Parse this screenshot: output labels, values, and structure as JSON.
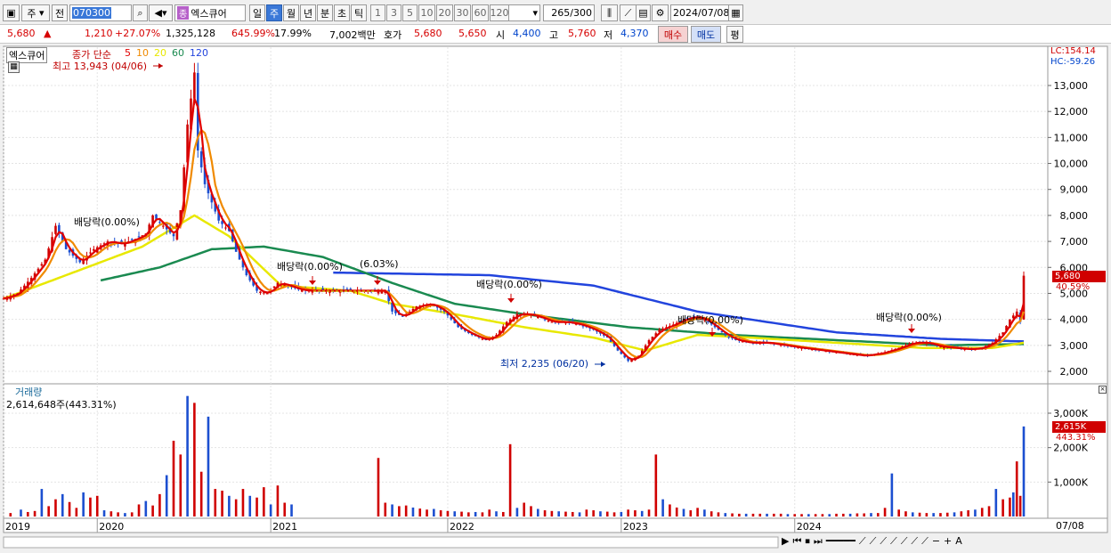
{
  "toolbar": {
    "market_sel": "주",
    "prev_label": "전",
    "stock_code": "070300",
    "stock_badge": "종",
    "stock_name": "엑스큐어",
    "periods": [
      "일",
      "주",
      "월",
      "년",
      "분",
      "초",
      "틱"
    ],
    "active_period": "주",
    "intervals": [
      "1",
      "3",
      "5",
      "10",
      "20",
      "30",
      "60",
      "120"
    ],
    "count": "265",
    "count_total": "/300",
    "date": "2024/07/08"
  },
  "quote": {
    "price": "5,680",
    "change_arrow": "▲",
    "change": "1,210",
    "change_pct": "+27.07%",
    "volume": "1,325,128",
    "volume_ratio": "645.99%",
    "turnover": "17.99%",
    "amount": "7,002백만",
    "hoga_label": "호가",
    "ask": "5,680",
    "bid": "5,650",
    "open_label": "시",
    "open": "4,400",
    "high_label": "고",
    "high": "5,760",
    "low_label": "저",
    "low": "4,370",
    "buy_button": "매수",
    "sell_button": "매도",
    "eval_button": "평"
  },
  "price_panel": {
    "stock_tag": "엑스큐어",
    "legend_prefix": "종가 단순",
    "ma_periods": [
      "5",
      "10",
      "20",
      "60",
      "120"
    ],
    "ma_colors": [
      "#e00000",
      "#f08a00",
      "#e8e800",
      "#1a8a50",
      "#2244dd"
    ],
    "lc": "LC:154.14",
    "hc": "HC:-59.26",
    "high_note": "최고 13,943 (04/06)",
    "low_note": "최저 2,235 (06/20)",
    "dividend_notes": [
      "배당락(0.00%)",
      "배당락(0.00%)",
      "(6.03%)",
      "배당락(0.00%)",
      "배당락(0.00%)",
      "배당락(0.00%)"
    ],
    "last_price_tag": "5,680",
    "last_pct_tag": "40.59%"
  },
  "volume_panel": {
    "title": "거래량",
    "value_line": "2,614,648주(443.31%)",
    "last_vol_tag": "2,615K",
    "last_vol_pct": "443.31%"
  },
  "x_axis": {
    "labels": [
      "2019",
      "2020",
      "2021",
      "2022",
      "2023",
      "2024"
    ],
    "right_date": "07/08"
  },
  "chart_data": {
    "type": "candlestick",
    "price_axis": {
      "ticks": [
        "2,000",
        "3,000",
        "4,000",
        "5,000",
        "6,000",
        "7,000",
        "8,000",
        "9,000",
        "10,000",
        "11,000",
        "12,000",
        "13,000"
      ],
      "ylim": [
        1500,
        14500
      ]
    },
    "volume_axis": {
      "ticks": [
        "1,000K",
        "2,000K",
        "3,000K"
      ],
      "ylim": [
        0,
        3500000
      ]
    },
    "anchors": [
      [
        0,
        4800
      ],
      [
        4,
        5000
      ],
      [
        8,
        5600
      ],
      [
        12,
        6300
      ],
      [
        15,
        7600
      ],
      [
        18,
        6700
      ],
      [
        22,
        6200
      ],
      [
        26,
        6700
      ],
      [
        30,
        7000
      ],
      [
        34,
        6900
      ],
      [
        38,
        7100
      ],
      [
        41,
        7300
      ],
      [
        43,
        8000
      ],
      [
        46,
        7600
      ],
      [
        49,
        7200
      ],
      [
        51,
        8200
      ],
      [
        53,
        11500
      ],
      [
        55,
        13500
      ],
      [
        56,
        10500
      ],
      [
        58,
        9200
      ],
      [
        60,
        8500
      ],
      [
        62,
        7800
      ],
      [
        65,
        7400
      ],
      [
        67,
        6600
      ],
      [
        70,
        5700
      ],
      [
        73,
        5100
      ],
      [
        76,
        5000
      ],
      [
        79,
        5400
      ],
      [
        82,
        5300
      ],
      [
        85,
        5150
      ],
      [
        88,
        5100
      ],
      [
        92,
        5100
      ],
      [
        100,
        5100
      ],
      [
        110,
        5100
      ],
      [
        112,
        4300
      ],
      [
        115,
        4100
      ],
      [
        119,
        4500
      ],
      [
        123,
        4600
      ],
      [
        127,
        4300
      ],
      [
        131,
        3700
      ],
      [
        135,
        3400
      ],
      [
        139,
        3200
      ],
      [
        142,
        3400
      ],
      [
        145,
        3900
      ],
      [
        148,
        4200
      ],
      [
        151,
        4200
      ],
      [
        154,
        4100
      ],
      [
        158,
        3900
      ],
      [
        162,
        3900
      ],
      [
        166,
        3800
      ],
      [
        170,
        3600
      ],
      [
        174,
        3300
      ],
      [
        177,
        2800
      ],
      [
        180,
        2400
      ],
      [
        183,
        2600
      ],
      [
        186,
        3200
      ],
      [
        189,
        3600
      ],
      [
        193,
        3800
      ],
      [
        196,
        4000
      ],
      [
        199,
        4100
      ],
      [
        202,
        4000
      ],
      [
        205,
        3700
      ],
      [
        208,
        3400
      ],
      [
        211,
        3200
      ],
      [
        215,
        3100
      ],
      [
        220,
        3100
      ],
      [
        225,
        3000
      ],
      [
        230,
        2900
      ],
      [
        236,
        2800
      ],
      [
        242,
        2700
      ],
      [
        248,
        2600
      ],
      [
        253,
        2700
      ],
      [
        258,
        2900
      ],
      [
        262,
        3100
      ],
      [
        266,
        3100
      ],
      [
        270,
        2950
      ],
      [
        274,
        2900
      ],
      [
        278,
        2850
      ],
      [
        282,
        2900
      ],
      [
        285,
        3100
      ],
      [
        288,
        3500
      ],
      [
        290,
        4000
      ],
      [
        292,
        4300
      ],
      [
        293,
        3900
      ],
      [
        294,
        5680
      ]
    ],
    "ma120_anchors": [
      [
        95,
        5800
      ],
      [
        140,
        5700
      ],
      [
        170,
        5300
      ],
      [
        200,
        4300
      ],
      [
        240,
        3500
      ],
      [
        270,
        3250
      ],
      [
        294,
        3150
      ]
    ],
    "ma60_anchors": [
      [
        28,
        5500
      ],
      [
        45,
        6000
      ],
      [
        60,
        6700
      ],
      [
        75,
        6800
      ],
      [
        92,
        6400
      ],
      [
        112,
        5400
      ],
      [
        130,
        4600
      ],
      [
        150,
        4200
      ],
      [
        180,
        3700
      ],
      [
        210,
        3400
      ],
      [
        240,
        3200
      ],
      [
        270,
        3000
      ],
      [
        294,
        3050
      ]
    ],
    "ma20_anchors": [
      [
        0,
        4800
      ],
      [
        20,
        5800
      ],
      [
        40,
        6800
      ],
      [
        55,
        8000
      ],
      [
        65,
        7200
      ],
      [
        80,
        5300
      ],
      [
        100,
        5100
      ],
      [
        112,
        4600
      ],
      [
        130,
        4200
      ],
      [
        150,
        3700
      ],
      [
        170,
        3300
      ],
      [
        185,
        2800
      ],
      [
        200,
        3400
      ],
      [
        215,
        3300
      ],
      [
        240,
        3100
      ],
      [
        265,
        2900
      ],
      [
        285,
        2900
      ],
      [
        294,
        3100
      ]
    ],
    "volumes": [
      [
        2,
        100000
      ],
      [
        5,
        200000
      ],
      [
        7,
        130000
      ],
      [
        9,
        160000
      ],
      [
        11,
        800000
      ],
      [
        13,
        300000
      ],
      [
        15,
        500000
      ],
      [
        17,
        650000
      ],
      [
        19,
        420000
      ],
      [
        21,
        250000
      ],
      [
        23,
        700000
      ],
      [
        25,
        550000
      ],
      [
        27,
        600000
      ],
      [
        29,
        180000
      ],
      [
        31,
        150000
      ],
      [
        33,
        120000
      ],
      [
        35,
        100000
      ],
      [
        37,
        120000
      ],
      [
        39,
        350000
      ],
      [
        41,
        450000
      ],
      [
        43,
        320000
      ],
      [
        45,
        650000
      ],
      [
        47,
        1200000
      ],
      [
        49,
        2200000
      ],
      [
        51,
        1800000
      ],
      [
        53,
        3500000
      ],
      [
        55,
        3300000
      ],
      [
        57,
        1300000
      ],
      [
        59,
        2900000
      ],
      [
        61,
        800000
      ],
      [
        63,
        750000
      ],
      [
        65,
        600000
      ],
      [
        67,
        500000
      ],
      [
        69,
        800000
      ],
      [
        71,
        600000
      ],
      [
        73,
        550000
      ],
      [
        75,
        850000
      ],
      [
        77,
        350000
      ],
      [
        79,
        900000
      ],
      [
        81,
        400000
      ],
      [
        83,
        350000
      ],
      [
        108,
        1700000
      ],
      [
        110,
        400000
      ],
      [
        112,
        350000
      ],
      [
        114,
        300000
      ],
      [
        116,
        320000
      ],
      [
        118,
        260000
      ],
      [
        120,
        230000
      ],
      [
        122,
        200000
      ],
      [
        124,
        220000
      ],
      [
        126,
        180000
      ],
      [
        128,
        160000
      ],
      [
        130,
        150000
      ],
      [
        132,
        140000
      ],
      [
        134,
        120000
      ],
      [
        136,
        130000
      ],
      [
        138,
        120000
      ],
      [
        140,
        200000
      ],
      [
        142,
        150000
      ],
      [
        144,
        130000
      ],
      [
        146,
        2100000
      ],
      [
        148,
        250000
      ],
      [
        150,
        400000
      ],
      [
        152,
        300000
      ],
      [
        154,
        220000
      ],
      [
        156,
        180000
      ],
      [
        158,
        160000
      ],
      [
        160,
        150000
      ],
      [
        162,
        140000
      ],
      [
        164,
        130000
      ],
      [
        166,
        120000
      ],
      [
        168,
        200000
      ],
      [
        170,
        180000
      ],
      [
        172,
        150000
      ],
      [
        174,
        140000
      ],
      [
        176,
        120000
      ],
      [
        178,
        130000
      ],
      [
        180,
        200000
      ],
      [
        182,
        180000
      ],
      [
        184,
        160000
      ],
      [
        186,
        200000
      ],
      [
        188,
        1800000
      ],
      [
        190,
        500000
      ],
      [
        192,
        350000
      ],
      [
        194,
        260000
      ],
      [
        196,
        220000
      ],
      [
        198,
        180000
      ],
      [
        200,
        250000
      ],
      [
        202,
        200000
      ],
      [
        204,
        150000
      ],
      [
        206,
        120000
      ],
      [
        208,
        100000
      ],
      [
        210,
        90000
      ],
      [
        212,
        80000
      ],
      [
        214,
        80000
      ],
      [
        216,
        80000
      ],
      [
        218,
        80000
      ],
      [
        220,
        80000
      ],
      [
        222,
        80000
      ],
      [
        224,
        80000
      ],
      [
        226,
        70000
      ],
      [
        228,
        70000
      ],
      [
        230,
        70000
      ],
      [
        232,
        70000
      ],
      [
        234,
        70000
      ],
      [
        236,
        70000
      ],
      [
        238,
        70000
      ],
      [
        240,
        80000
      ],
      [
        242,
        80000
      ],
      [
        244,
        80000
      ],
      [
        246,
        90000
      ],
      [
        248,
        90000
      ],
      [
        250,
        100000
      ],
      [
        252,
        100000
      ],
      [
        254,
        250000
      ],
      [
        256,
        1250000
      ],
      [
        258,
        200000
      ],
      [
        260,
        150000
      ],
      [
        262,
        120000
      ],
      [
        264,
        110000
      ],
      [
        266,
        100000
      ],
      [
        268,
        100000
      ],
      [
        270,
        100000
      ],
      [
        272,
        110000
      ],
      [
        274,
        120000
      ],
      [
        276,
        150000
      ],
      [
        278,
        180000
      ],
      [
        280,
        200000
      ],
      [
        282,
        250000
      ],
      [
        284,
        300000
      ],
      [
        286,
        800000
      ],
      [
        288,
        500000
      ],
      [
        290,
        550000
      ],
      [
        291,
        700000
      ],
      [
        292,
        1600000
      ],
      [
        293,
        600000
      ],
      [
        294,
        2615000
      ]
    ],
    "x_labels": [
      "2019",
      "2020",
      "2021",
      "2022",
      "2023",
      "2024"
    ],
    "x_label_weeks": [
      0,
      27,
      77,
      128,
      178,
      228
    ]
  }
}
